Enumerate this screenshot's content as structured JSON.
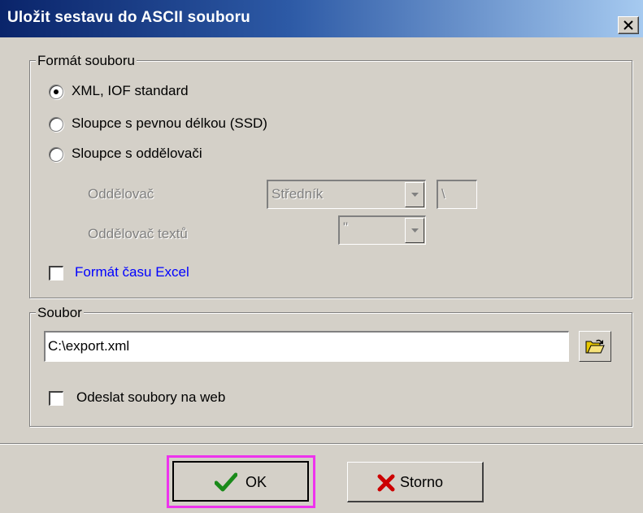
{
  "window": {
    "title": "Uložit sestavu do ASCII souboru",
    "close_label": "close"
  },
  "format_group": {
    "legend": "Formát souboru",
    "options": [
      {
        "label": "XML, IOF standard",
        "checked": true
      },
      {
        "label": "Sloupce s pevnou délkou (SSD)",
        "checked": false
      },
      {
        "label": "Sloupce s oddělovači",
        "checked": false
      }
    ],
    "separator_label": "Oddělovač",
    "separator_value": "Středník",
    "separator_char": "\\",
    "text_separator_label": "Oddělovač textů",
    "text_separator_value": "\"",
    "excel_time_label": "Formát času Excel",
    "excel_time_checked": false
  },
  "file_group": {
    "legend": "Soubor",
    "path_value": "C:\\export.xml",
    "send_web_label": "Odeslat soubory na web",
    "send_web_checked": false
  },
  "buttons": {
    "ok_label": "OK",
    "cancel_label": "Storno"
  },
  "colors": {
    "ok_check": "#1a8a1a",
    "cancel_x": "#cc0000",
    "highlight": "#ee33ee",
    "link": "#0000ff"
  }
}
